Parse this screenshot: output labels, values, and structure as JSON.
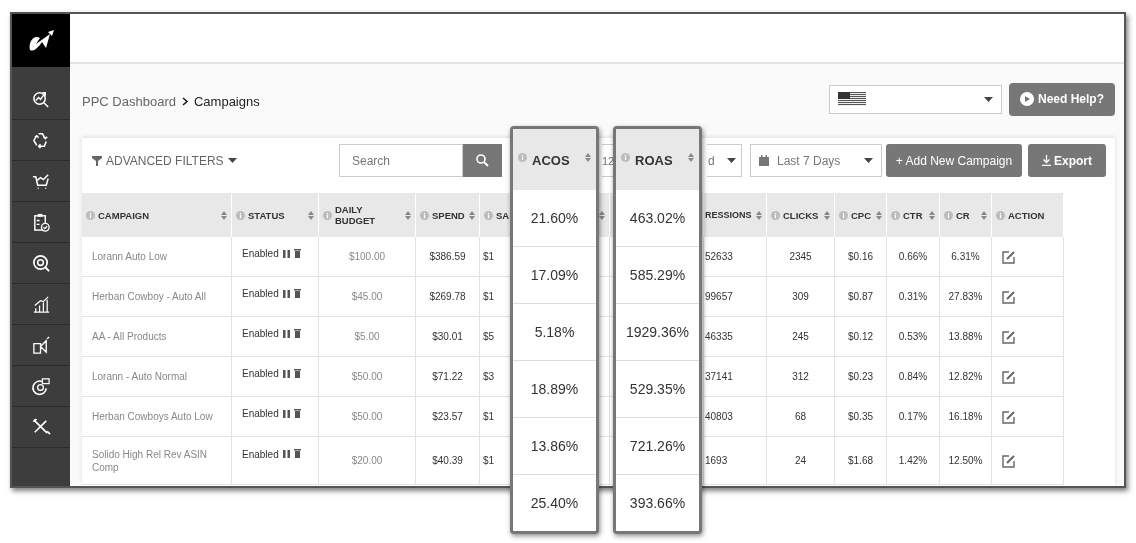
{
  "breadcrumb": {
    "parent": "PPC Dashboard",
    "current": "Campaigns"
  },
  "help_button": "Need Help?",
  "toolbar": {
    "filters": "ADVANCED FILTERS",
    "search": {
      "placeholder": "Search"
    },
    "dropdown_1": "12",
    "dropdown_2": "d",
    "date_range": "Last 7 Days",
    "add_button": "+ Add New Campaign",
    "export_button": "Export"
  },
  "table": {
    "columns": [
      {
        "label": "CAMPAIGN",
        "sortable": true
      },
      {
        "label": "STATUS",
        "sortable": true
      },
      {
        "label": "DAILY BUDGET",
        "sortable": true
      },
      {
        "label": "SPEND",
        "sortable": true
      },
      {
        "label": "SA",
        "sortable": true
      },
      {
        "label": "RESSIONS",
        "sortable": true
      },
      {
        "label": "CLICKS",
        "sortable": true
      },
      {
        "label": "CPC",
        "sortable": true
      },
      {
        "label": "CTR",
        "sortable": true
      },
      {
        "label": "CR",
        "sortable": true
      },
      {
        "label": "ACTION",
        "sortable": false
      }
    ],
    "rows": [
      {
        "campaign": "Lorann Auto Low",
        "status": "Enabled",
        "daily_budget": "$100.00",
        "spend": "$386.59",
        "sales": "$1",
        "impressions": "52633",
        "clicks": "2345",
        "cpc": "$0.16",
        "ctr": "0.66%",
        "cr": "6.31%"
      },
      {
        "campaign": "Herban Cowboy - Auto All",
        "status": "Enabled",
        "daily_budget": "$45.00",
        "spend": "$269.78",
        "sales": "$1",
        "impressions": "99657",
        "clicks": "309",
        "cpc": "$0.87",
        "ctr": "0.31%",
        "cr": "27.83%"
      },
      {
        "campaign": "AA - All Products",
        "status": "Enabled",
        "daily_budget": "$5.00",
        "spend": "$30.01",
        "sales": "$5",
        "impressions": "46335",
        "clicks": "245",
        "cpc": "$0.12",
        "ctr": "0.53%",
        "cr": "13.88%"
      },
      {
        "campaign": "Lorann - Auto Normal",
        "status": "Enabled",
        "daily_budget": "$50.00",
        "spend": "$71.22",
        "sales": "$3",
        "impressions": "37141",
        "clicks": "312",
        "cpc": "$0.23",
        "ctr": "0.84%",
        "cr": "12.82%"
      },
      {
        "campaign": "Herban Cowboys Auto Low",
        "status": "Enabled",
        "daily_budget": "$50.00",
        "spend": "$23.57",
        "sales": "$1",
        "impressions": "40803",
        "clicks": "68",
        "cpc": "$0.35",
        "ctr": "0.17%",
        "cr": "16.18%"
      },
      {
        "campaign": "Solido High Rel Rev ASIN Comp",
        "status": "Enabled",
        "daily_budget": "$20.00",
        "spend": "$40.39",
        "sales": "$1",
        "impressions": "1693",
        "clicks": "24",
        "cpc": "$1.68",
        "ctr": "1.42%",
        "cr": "12.50%"
      }
    ]
  },
  "highlights": [
    {
      "title": "ACOS",
      "values": [
        "21.60%",
        "17.09%",
        "5.18%",
        "18.89%",
        "13.86%",
        "25.40%"
      ]
    },
    {
      "title": "ROAS",
      "values": [
        "463.02%",
        "585.29%",
        "1929.36%",
        "529.35%",
        "721.26%",
        "393.66%"
      ]
    }
  ]
}
